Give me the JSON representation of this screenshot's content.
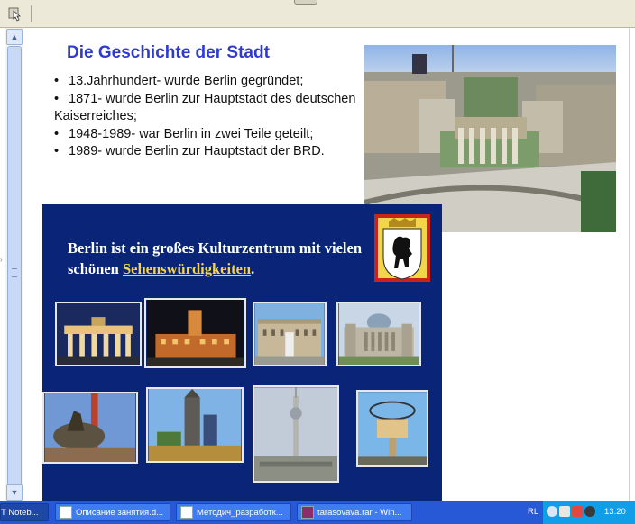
{
  "document": {
    "title": "Die Geschichte der Stadt",
    "bullets": [
      "13.Jahrhundert- wurde Berlin gegründet;",
      "1871- wurde Berlin zur Hauptstadt des deutschen Kaiserreiches;",
      "1948-1989- war Berlin in zwei Teile geteilt;",
      "1989- wurde Berlin zur Hauptstadt der BRD."
    ]
  },
  "slide": {
    "text_before_link": "Berlin ist ein großes Kulturzentrum mit vielen schönen ",
    "link_text": "Sehenswürdigkeiten",
    "text_after_link": ".",
    "background_color": "#0a2478",
    "link_color": "#f7d54a"
  },
  "taskbar": {
    "tasks": [
      {
        "label": "T Noteb...",
        "icon": "notebook-icon"
      },
      {
        "label": "Описание занятия.d...",
        "icon": "word-document-icon"
      },
      {
        "label": "Методич_разработк...",
        "icon": "word-document-icon"
      },
      {
        "label": "tarasovava.rar - Win...",
        "icon": "winrar-icon"
      }
    ],
    "language": "RL",
    "clock": "13:20"
  },
  "colors": {
    "title": "#2f3ad0",
    "taskbar": "#2758d6",
    "tray": "#0f9ee7"
  }
}
